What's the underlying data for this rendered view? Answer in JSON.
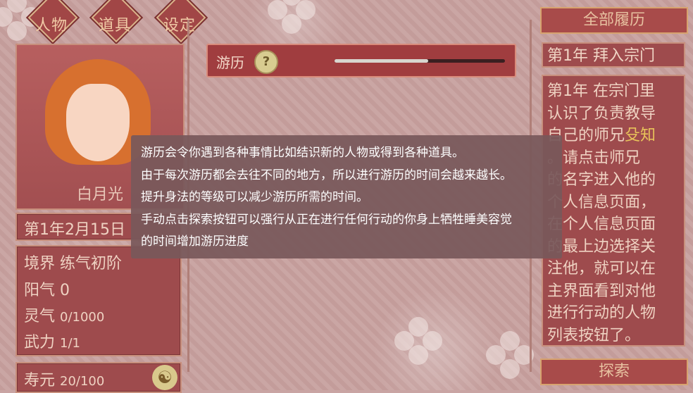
{
  "nav": {
    "characters": "人物",
    "items": "道具",
    "settings": "设定"
  },
  "character": {
    "name": "白月光",
    "date": "第1年2月15日",
    "realm": "境界 练气初阶",
    "yang_label": "阳气",
    "yang_value": "0",
    "spirit_label": "灵气",
    "spirit_value": "0/1000",
    "force_label": "武力",
    "force_value": "1/1",
    "lifespan_label": "寿元",
    "lifespan_value": "20/100"
  },
  "travel": {
    "label": "游历",
    "help_glyph": "?",
    "progress": 0.55
  },
  "sidebar": {
    "history_button": "全部履历",
    "entry_title": "第1年 拜入宗门",
    "entry_lines": [
      "第1年 在宗门里",
      "认识了负责教导",
      "自己的师兄",
      "。请点击师兄",
      "的名字进入他的",
      "个人信息页面，",
      "在个人信息页面",
      "的最上边选择关",
      "注他，就可以在",
      "主界面看到对他",
      "进行行动的人物",
      "列表按钮了。"
    ],
    "highlight_name": "殳知",
    "explore_button": "探索"
  },
  "tooltip": {
    "lines": [
      "游历会令你遇到各种事情比如结识新的人物或得到各种道具。",
      "由于每次游历都会去往不同的地方，所以进行游历的时间会越来越长。",
      "提升身法的等级可以减少游历所需的时间。",
      "手动点击探索按钮可以强行从正在进行任何行动的你身上牺牲睡美容觉",
      "的时间增加游历进度"
    ]
  },
  "colors": {
    "panel": "#9e4b4d",
    "panel_border": "#c88f7c",
    "tooltip_bg": "#78585a",
    "highlight": "#e8c35a"
  }
}
